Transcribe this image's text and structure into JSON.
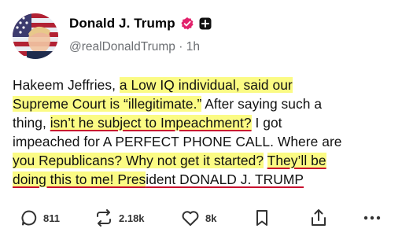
{
  "author": {
    "display_name": "Donald J. Trump",
    "handle": "@realDonaldTrump",
    "separator": "·",
    "time": "1h"
  },
  "post": {
    "lines": [
      [
        {
          "t": "Hakeem Jeffries, ",
          "hl": false
        },
        {
          "t": "a Low IQ individual, said our",
          "hl": true
        }
      ],
      [
        {
          "t": "Supreme Court is “illegitimate.”",
          "hl": true
        },
        {
          "t": " After saying such a",
          "hl": false
        }
      ],
      [
        {
          "t": "thing, ",
          "hl": false
        },
        {
          "t": "isn’t he subject to ",
          "hl": true,
          "ul": true
        },
        {
          "t": "Impeachment?",
          "hl": true,
          "ul": true
        },
        {
          "t": " I got",
          "hl": false
        }
      ],
      [
        {
          "t": "impeached for A PERFECT PHONE CALL. Where are",
          "hl": false
        }
      ],
      [
        {
          "t": "you Republicans? Why not get it started?",
          "hl": true
        },
        {
          "t": " ",
          "hl": false
        },
        {
          "t": "They’ll be",
          "hl": true,
          "ul": true
        }
      ],
      [
        {
          "t": "doing this to me! Pres",
          "hl": true,
          "ul": true
        },
        {
          "t": "ident DONALD J. TRUMP",
          "hl": false,
          "ul": true
        }
      ]
    ]
  },
  "actions": {
    "replies": "811",
    "reposts": "2.18k",
    "likes": "8k"
  },
  "icons": {
    "verified": "verified-badge-icon",
    "plus": "plus-badge-icon",
    "reply": "reply-icon",
    "repost": "repost-icon",
    "like": "heart-icon",
    "bookmark": "bookmark-icon",
    "share": "share-icon",
    "more": "more-icon"
  },
  "colors": {
    "highlight": "#fbfb84",
    "underline": "#c8102e",
    "verified": "#e2216b",
    "muted": "#6b6e72"
  }
}
